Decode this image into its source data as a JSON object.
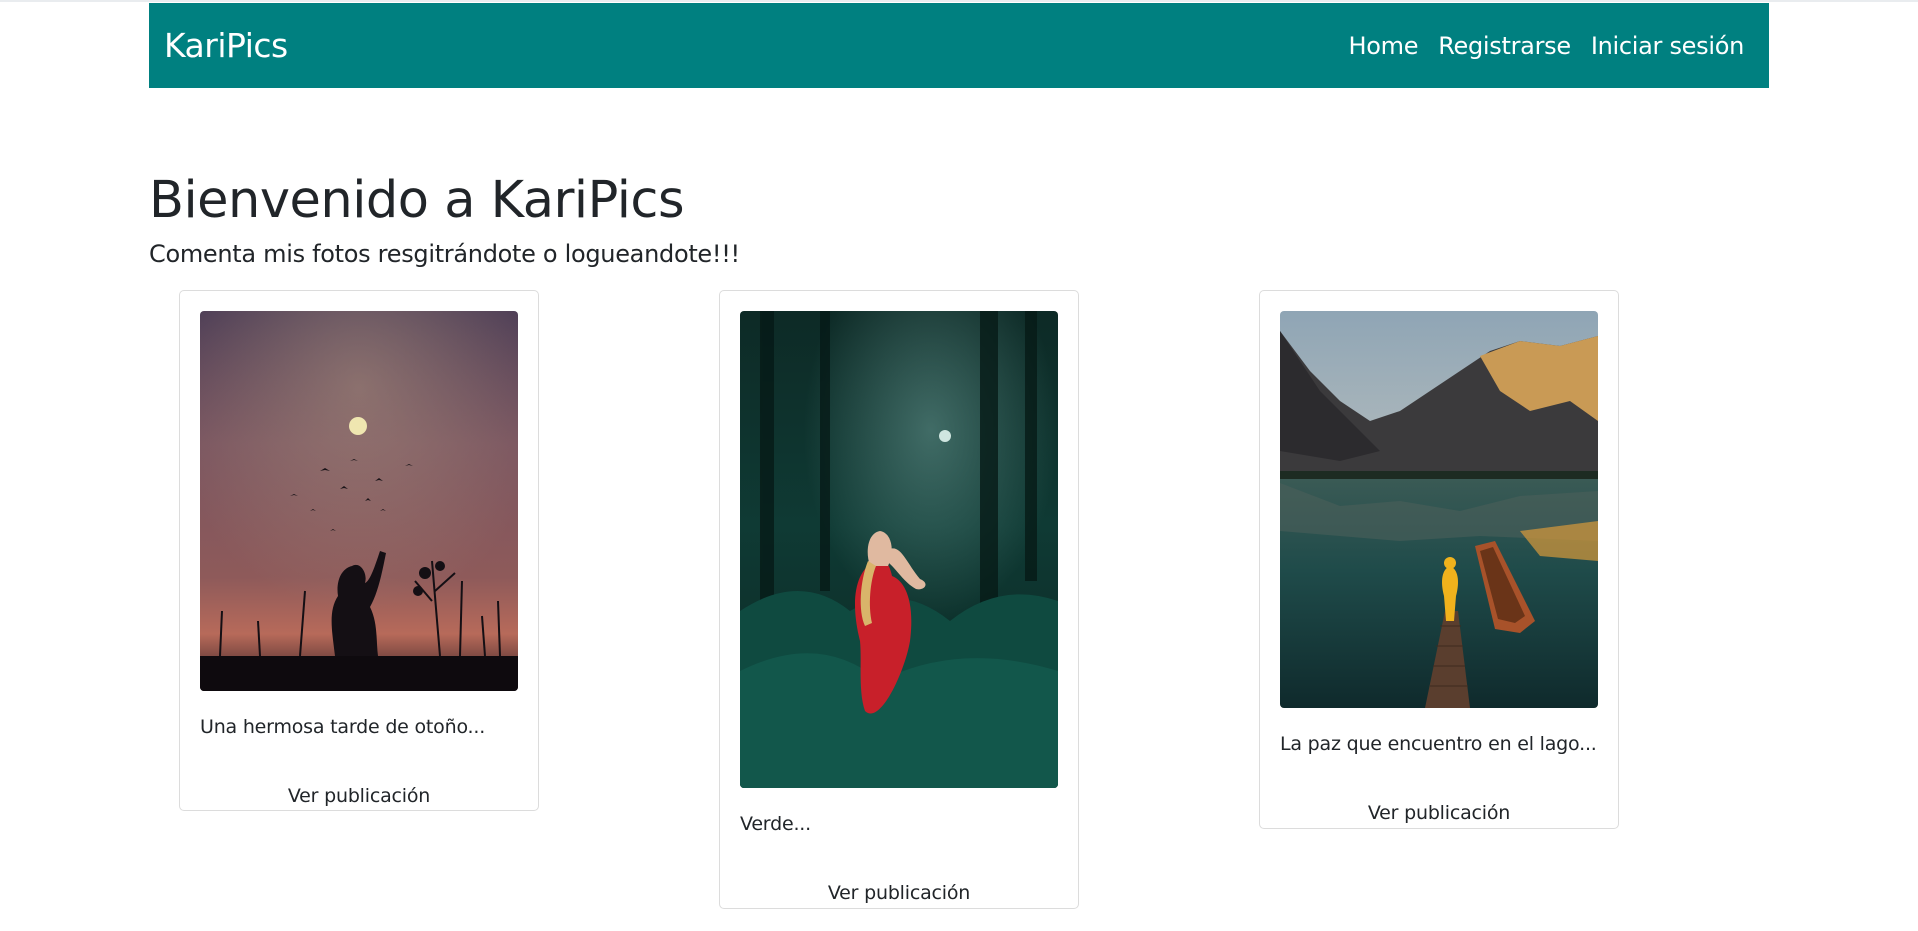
{
  "nav": {
    "brand": "KariPics",
    "links": [
      "Home",
      "Registrarse",
      "Iniciar sesión"
    ]
  },
  "hero": {
    "title": "Bienvenido a KariPics",
    "subtitle": "Comenta mis fotos resgitrándote o logueandote!!!"
  },
  "cards": [
    {
      "caption": "Una hermosa tarde de otoño...",
      "link": "Ver publicación"
    },
    {
      "caption": "Verde...",
      "link": "Ver publicación"
    },
    {
      "caption": "La paz que encuentro en el lago...",
      "link": "Ver publicación"
    }
  ],
  "colors": {
    "navbar": "#008080",
    "text": "#212529",
    "card_border": "#dcdcdc"
  }
}
